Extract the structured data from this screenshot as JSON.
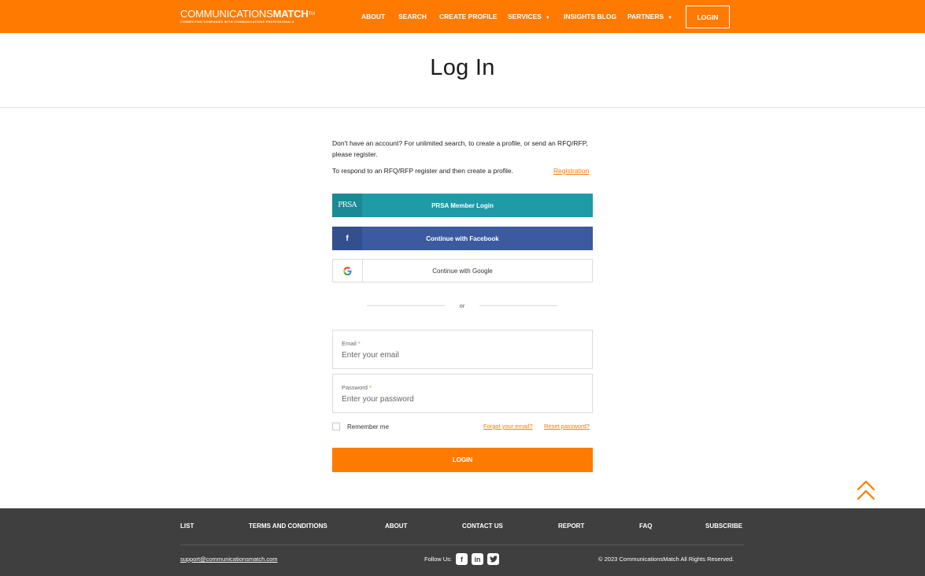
{
  "header": {
    "logo_main": "COMMUNICATIONS",
    "logo_bold": "MATCH",
    "logo_tm": "TM",
    "logo_tagline": "CONNECTING COMPANIES WITH COMMUNICATIONS PROFESSIONALS",
    "nav": {
      "about": "ABOUT",
      "search": "SEARCH",
      "create_profile": "CREATE PROFILE",
      "services": "SERVICES",
      "insights_blog": "INSIGHTS BLOG",
      "partners": "PARTNERS"
    },
    "login_label": "LOGIN"
  },
  "page_title": "Log In",
  "intro": {
    "text1": "Don't have an account? For unlimited search, to create a profile, or send an RFQ/RFP, please register.",
    "text2": "To respond to an RFQ/RFP register and then create a profile.",
    "registration_link": "Registration"
  },
  "social": {
    "prsa_logo": "PRSA",
    "prsa_label": "PRSA Member Login",
    "facebook_icon": "f",
    "facebook_label": "Continue with Facebook",
    "google_label": "Continue with Google"
  },
  "divider_text": "or",
  "form": {
    "email_label": "Email",
    "email_placeholder": "Enter your email",
    "password_label": "Password",
    "password_placeholder": "Enter your password",
    "required_mark": "*",
    "remember_label": "Remember me",
    "forgot_email": "Forgot your email?",
    "reset_password": "Reset password?",
    "submit_label": "LOGIN"
  },
  "footer": {
    "nav": {
      "list": "LIST",
      "terms": "TERMS AND CONDITIONS",
      "about": "ABOUT",
      "contact": "CONTACT US",
      "report": "REPORT",
      "faq": "FAQ",
      "subscribe": "SUBSCRIBE"
    },
    "email": "support@communicationsmatch.com",
    "follow_label": "Follow Us:",
    "copyright": "© 2023 CommunicationsMatch All Rights Reserved."
  },
  "colors": {
    "brand_orange": "#ff7a00",
    "prsa_teal": "#1e9ba6",
    "facebook_blue": "#3b5aa0",
    "footer_gray": "#3f3f3f"
  },
  "icons": [
    "caret-down-icon",
    "prsa-logo-icon",
    "facebook-icon",
    "google-icon",
    "scroll-top-icon",
    "linkedin-icon",
    "twitter-icon"
  ]
}
